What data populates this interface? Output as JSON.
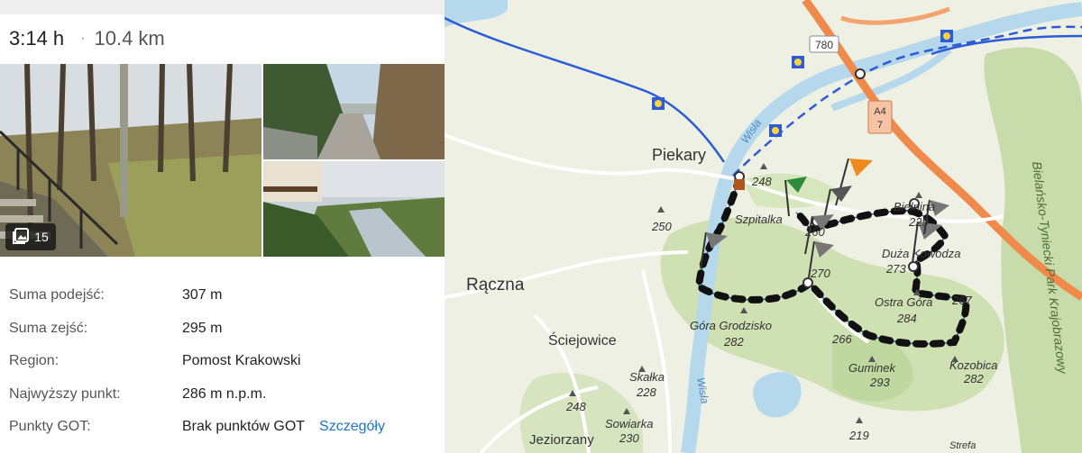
{
  "summary": {
    "duration": "3:14 h",
    "separator": "·",
    "distance": "10.4 km"
  },
  "gallery": {
    "photo_count": "15",
    "icon": "photo-gallery-icon"
  },
  "stats": [
    {
      "label": "Suma podejść:",
      "value": "307 m"
    },
    {
      "label": "Suma zejść:",
      "value": "295 m"
    },
    {
      "label": "Region:",
      "value": "Pomost Krakowski"
    },
    {
      "label": "Najwyższy punkt:",
      "value": "286 m n.p.m."
    },
    {
      "label": "Punkty GOT:",
      "value": "Brak punktów GOT",
      "link": "Szczegóły"
    }
  ],
  "map": {
    "road_numbers": {
      "road_780": "780",
      "a4_line1": "A4",
      "a4_line2": "7"
    },
    "river_labels": {
      "wisla_north": "Wisła",
      "wisla_south": "Wisła"
    },
    "towns": {
      "piekary": "Piekary",
      "raczna": "Rączna",
      "sciejowice": "Ściejowice",
      "jeziorzany": "Jeziorzany",
      "strefa": "Strefa"
    },
    "places": {
      "szpitalka": "Szpitalka",
      "bielnina": "Bielnina",
      "duza_kowodza": "Duża Kowodza",
      "ostra_gora": "Ostra Góra",
      "gora_grodzisko": "Góra Grodzisko",
      "skalka": "Skałka",
      "sowiarka": "Sowiarka",
      "guminek": "Guminek",
      "kozobica": "Kozobica",
      "park": "Bielańsko-Tyniecki Park Krajobrazowy"
    },
    "elevations": {
      "e248a": "248",
      "e250": "250",
      "e260": "260",
      "e229": "229",
      "e273": "273",
      "e270": "270",
      "e267": "267",
      "e284": "284",
      "e282a": "282",
      "e266": "266",
      "e228": "228",
      "e248b": "248",
      "e230": "230",
      "e293": "293",
      "e282b": "282",
      "e219": "219"
    },
    "colors": {
      "route": "#111111",
      "river": "#b5d8ec",
      "trail": "#2b5bd6",
      "motorway": "#f08a4b"
    }
  }
}
